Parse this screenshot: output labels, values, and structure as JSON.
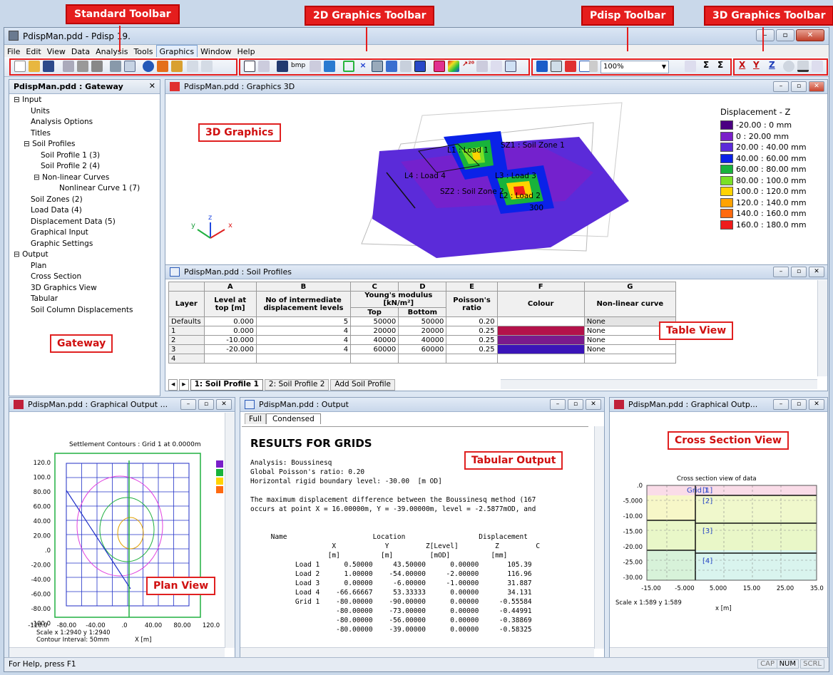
{
  "callouts": {
    "standard_toolbar": "Standard Toolbar",
    "graphics2d_toolbar": "2D Graphics Toolbar",
    "pdisp_toolbar": "Pdisp Toolbar",
    "graphics3d_toolbar": "3D Graphics Toolbar",
    "graphics3d": "3D Graphics",
    "gateway": "Gateway",
    "table_view": "Table View",
    "tabular_output": "Tabular Output",
    "plan_view": "Plan View",
    "cross_section_view": "Cross Section View"
  },
  "app": {
    "title": "PdispMan.pdd - Pdisp 19.",
    "window_buttons": [
      "–",
      "▫",
      "✕"
    ]
  },
  "menu": [
    "File",
    "Edit",
    "View",
    "Data",
    "Analysis",
    "Tools",
    "Graphics",
    "Window",
    "Help"
  ],
  "toolbar": {
    "zoom": "100%",
    "bmp_label": "bmp",
    "sigma1": "Σ",
    "sigma2": "Σ",
    "x_axis": "X",
    "y_axis": "Y",
    "z_axis": "Z"
  },
  "gateway": {
    "title": "PdispMan.pdd : Gateway",
    "close": "✕",
    "items": [
      "Input",
      "Units",
      "Analysis Options",
      "Titles",
      "Soil Profiles",
      "Soil Profile 1 (3)",
      "Soil Profile 2 (4)",
      "Non-linear Curves",
      "Nonlinear Curve 1 (7)",
      "Soil Zones (2)",
      "Load Data (4)",
      "Displacement Data (5)",
      "Graphical Input",
      "Graphic Settings",
      "Output",
      "Plan",
      "Cross Section",
      "3D Graphics View",
      "Tabular",
      "Soil Column Displacements"
    ]
  },
  "graphics3d": {
    "title": "PdispMan.pdd : Graphics 3D",
    "legend_title": "Displacement - Z",
    "legend": [
      {
        "label": "-20.00 : 0 mm",
        "color": "#4b0082"
      },
      {
        "label": "0 : 20.00 mm",
        "color": "#7a1fc9"
      },
      {
        "label": "20.00 : 40.00 mm",
        "color": "#5b2bd9"
      },
      {
        "label": "40.00 : 60.00 mm",
        "color": "#0a22e8"
      },
      {
        "label": "60.00 : 80.00 mm",
        "color": "#18b33b"
      },
      {
        "label": "80.00 : 100.0 mm",
        "color": "#7ae026"
      },
      {
        "label": "100.0 : 120.0 mm",
        "color": "#ffd300"
      },
      {
        "label": "120.0 : 140.0 mm",
        "color": "#ffa200"
      },
      {
        "label": "140.0 : 160.0 mm",
        "color": "#ff6a10"
      },
      {
        "label": "160.0 : 180.0 mm",
        "color": "#ee1c1c"
      }
    ],
    "labels": {
      "l1": "L1 : Load 1",
      "sz1": "SZ1 : Soil Zone 1",
      "l3": "L3 : Load 3",
      "l4": "L4 : Load 4",
      "sz2": "SZ2 : Soil Zone 2",
      "l2": "L2 : Load 2",
      "n300": "300"
    },
    "axes": {
      "y": "y",
      "z": "z",
      "x": "x"
    }
  },
  "soil_profiles": {
    "title": "PdispMan.pdd : Soil Profiles",
    "col_letters": [
      "A",
      "B",
      "C",
      "D",
      "E",
      "F",
      "G"
    ],
    "headers": {
      "layer": "Layer",
      "level": "Level at top [m]",
      "intermediate": "No of intermediate displacement levels",
      "youngs": "Young's modulus [kN/m²]",
      "top": "Top",
      "bottom": "Bottom",
      "poisson": "Poisson's ratio",
      "colour": "Colour",
      "nonlinear": "Non-linear curve"
    },
    "rows": [
      {
        "layer": "Defaults",
        "level": "0.000",
        "n": "5",
        "top": "50000",
        "bottom": "50000",
        "pr": "0.20",
        "colour": "",
        "curve": "None"
      },
      {
        "layer": "1",
        "level": "0.000",
        "n": "4",
        "top": "20000",
        "bottom": "20000",
        "pr": "0.25",
        "colour": "#b3124a",
        "curve": "None"
      },
      {
        "layer": "2",
        "level": "-10.000",
        "n": "4",
        "top": "40000",
        "bottom": "40000",
        "pr": "0.25",
        "colour": "#7a1a8c",
        "curve": "None"
      },
      {
        "layer": "3",
        "level": "-20.000",
        "n": "4",
        "top": "60000",
        "bottom": "60000",
        "pr": "0.25",
        "colour": "#3a14b8",
        "curve": "None"
      },
      {
        "layer": "4",
        "level": "",
        "n": "",
        "top": "",
        "bottom": "",
        "pr": "",
        "colour": "",
        "curve": ""
      }
    ],
    "tabs": [
      "1: Soil Profile 1",
      "2: Soil Profile 2",
      "Add Soil Profile"
    ]
  },
  "plan": {
    "title": "PdispMan.pdd : Graphical Output ...",
    "heading": "Settlement Contours : Grid 1 at 0.0000m",
    "y_ticks": [
      "120.0",
      "100.0",
      "80.00",
      "60.00",
      "40.00",
      "20.00",
      ".0",
      "-20.00",
      "-40.00",
      "-60.00",
      "-80.00",
      "-100.0"
    ],
    "x_ticks": [
      "-120.0",
      "-80.00",
      "-40.00",
      ".0",
      "40.00",
      "80.00",
      "120.0"
    ],
    "scale": "Scale x 1:2940  y 1:2940",
    "interval": "Contour Interval: 50mm",
    "xlabel": "X [m]"
  },
  "output": {
    "title": "PdispMan.pdd : Output",
    "tabs": [
      "Full",
      "Condensed"
    ],
    "heading": "RESULTS FOR GRIDS",
    "lines": [
      "Analysis: Boussinesq",
      "Global Poisson's ratio: 0.20",
      "Horizontal rigid boundary level: -30.00  [m OD]",
      "",
      "The maximum displacement difference between the Boussinesq method (167",
      "occurs at point X = 16.00000m, Y = -39.00000m, level = -2.5877mOD, and"
    ],
    "table_header": [
      "     Name                     Location                  Displacement",
      "                    X            Y         Z[Level]         Z         C",
      "                   [m]          [m]         [mOD]          [mm]"
    ],
    "table_rows": [
      "           Load 1      0.50000     43.50000      0.00000       105.39",
      "           Load 2      1.00000    -54.00000     -2.00000       116.96",
      "           Load 3      0.00000     -6.00000     -1.00000       31.887",
      "           Load 4    -66.66667     53.33333      0.00000       34.131",
      "           Grid 1    -80.00000    -90.00000      0.00000     -0.55584",
      "                     -80.00000    -73.00000      0.00000     -0.44991",
      "                     -80.00000    -56.00000      0.00000     -0.38869",
      "                     -80.00000    -39.00000      0.00000     -0.58325"
    ]
  },
  "cross_section": {
    "title": "PdispMan.pdd : Graphical Outp...",
    "heading": "Cross section view of data",
    "y_ticks": [
      ".0",
      "-5.000",
      "-10.00",
      "-15.00",
      "-20.00",
      "-25.00",
      "-30.00"
    ],
    "x_ticks": [
      "-15.00",
      "-5.000",
      "5.000",
      "15.00",
      "25.00",
      "35.00"
    ],
    "labels": [
      "Grid 1",
      "[1]",
      "[2]",
      "[3]",
      "[4]"
    ],
    "scale": "Scale x 1:589  y 1:589",
    "xlabel": "x [m]"
  },
  "status": {
    "help": "For Help, press F1",
    "cap": "CAP",
    "num": "NUM",
    "scrl": "SCRL"
  }
}
